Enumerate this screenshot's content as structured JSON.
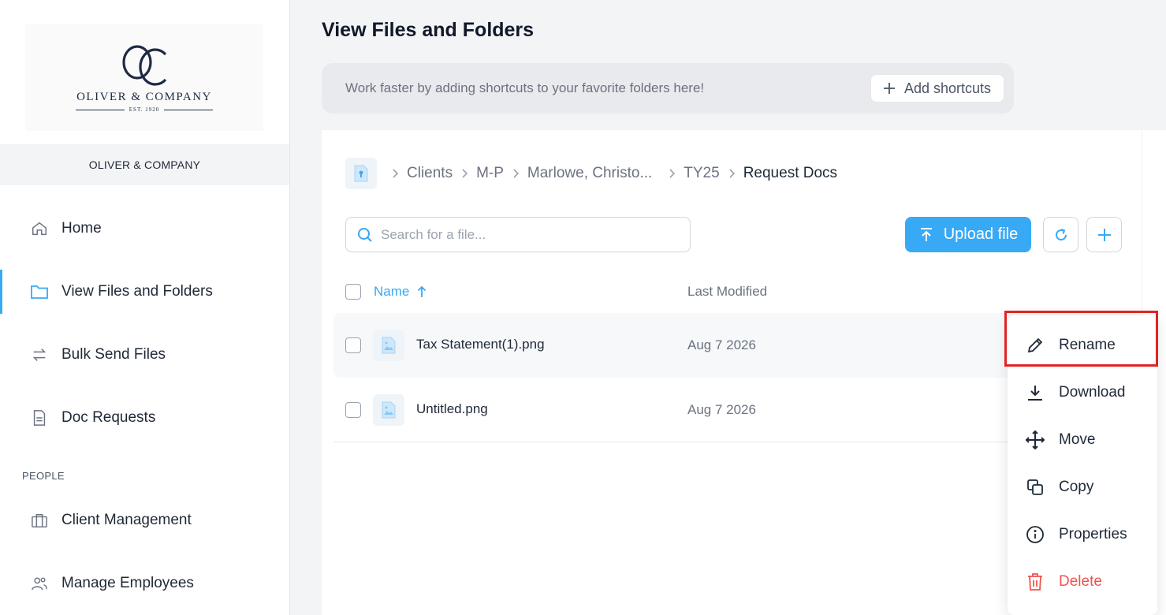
{
  "brand": {
    "logo_monogram": "OC",
    "logo_name": "OLIVER & COMPANY",
    "logo_est": "EST. 1920",
    "org_name": "OLIVER & COMPANY"
  },
  "sidebar": {
    "items": [
      {
        "label": "Home",
        "icon": "home-icon"
      },
      {
        "label": "View Files and Folders",
        "icon": "folder-icon",
        "active": true
      },
      {
        "label": "Bulk Send Files",
        "icon": "arrows-swap-icon"
      },
      {
        "label": "Doc Requests",
        "icon": "document-icon"
      }
    ],
    "section_people": "PEOPLE",
    "people_items": [
      {
        "label": "Client Management",
        "icon": "briefcase-icon"
      },
      {
        "label": "Manage Employees",
        "icon": "users-icon"
      }
    ]
  },
  "main": {
    "title": "View Files and Folders",
    "shortcut_text": "Work faster by adding shortcuts to your favorite folders here!",
    "add_shortcuts_label": "Add shortcuts",
    "breadcrumb": [
      "Clients",
      "M-P",
      "Marlowe, Christo...",
      "TY25",
      "Request Docs"
    ],
    "search_placeholder": "Search for a file...",
    "upload_label": "Upload file",
    "columns": {
      "name": "Name",
      "modified": "Last Modified"
    },
    "files": [
      {
        "name": "Tax Statement(1).png",
        "modified": "Aug 7 2026"
      },
      {
        "name": "Untitled.png",
        "modified": "Aug 7 2026"
      }
    ]
  },
  "context_menu": {
    "items": [
      {
        "label": "Rename",
        "icon": "pencil-icon"
      },
      {
        "label": "Download",
        "icon": "download-icon"
      },
      {
        "label": "Move",
        "icon": "move-icon"
      },
      {
        "label": "Copy",
        "icon": "copy-icon"
      },
      {
        "label": "Properties",
        "icon": "info-icon"
      },
      {
        "label": "Delete",
        "icon": "trash-icon"
      }
    ]
  },
  "colors": {
    "accent": "#38a9f5",
    "danger": "#ef5350",
    "highlight": "#e02424"
  }
}
